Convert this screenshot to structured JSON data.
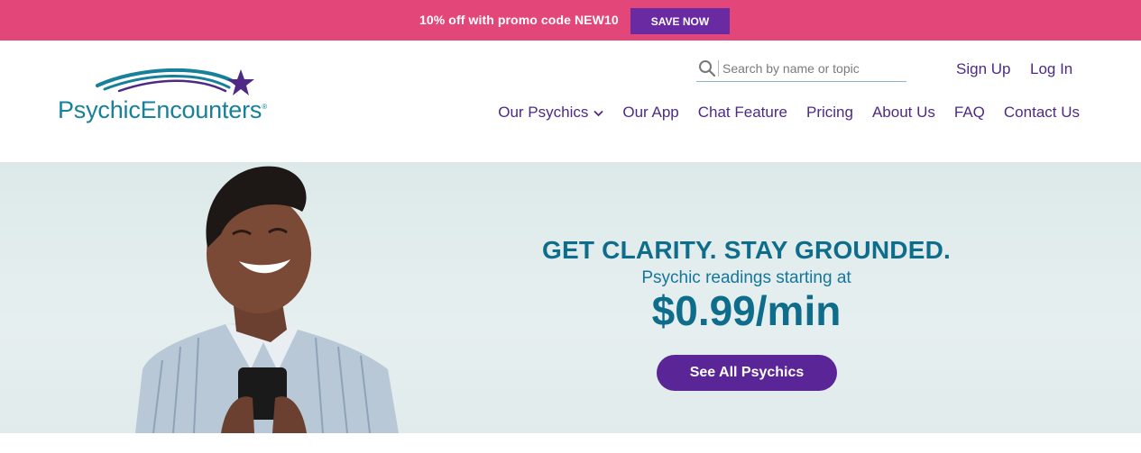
{
  "promo": {
    "text": "10% off with promo code NEW10",
    "button_label": "SAVE NOW",
    "bg_color": "#e3477a",
    "button_color": "#6a2aa1"
  },
  "header": {
    "logo_text": "PsychicEncounters",
    "logo_registered": "®",
    "search": {
      "placeholder": "Search by name or topic",
      "value": ""
    },
    "sign_up": "Sign Up",
    "log_in": "Log In",
    "nav": [
      {
        "label": "Our Psychics",
        "icon": "chevron-down-icon"
      },
      {
        "label": "Our App"
      },
      {
        "label": "Chat Feature"
      },
      {
        "label": "Pricing"
      },
      {
        "label": "About Us"
      },
      {
        "label": "FAQ"
      },
      {
        "label": "Contact Us"
      }
    ],
    "nav_color": "#4e2a84",
    "brand_color": "#17809a"
  },
  "hero": {
    "headline": "GET CLARITY. STAY GROUNDED.",
    "subheadline": "Psychic readings starting at",
    "price": "$0.99/min",
    "cta_label": "See All Psychics",
    "cta_color": "#5a2596",
    "text_color": "#0f6d8c"
  }
}
